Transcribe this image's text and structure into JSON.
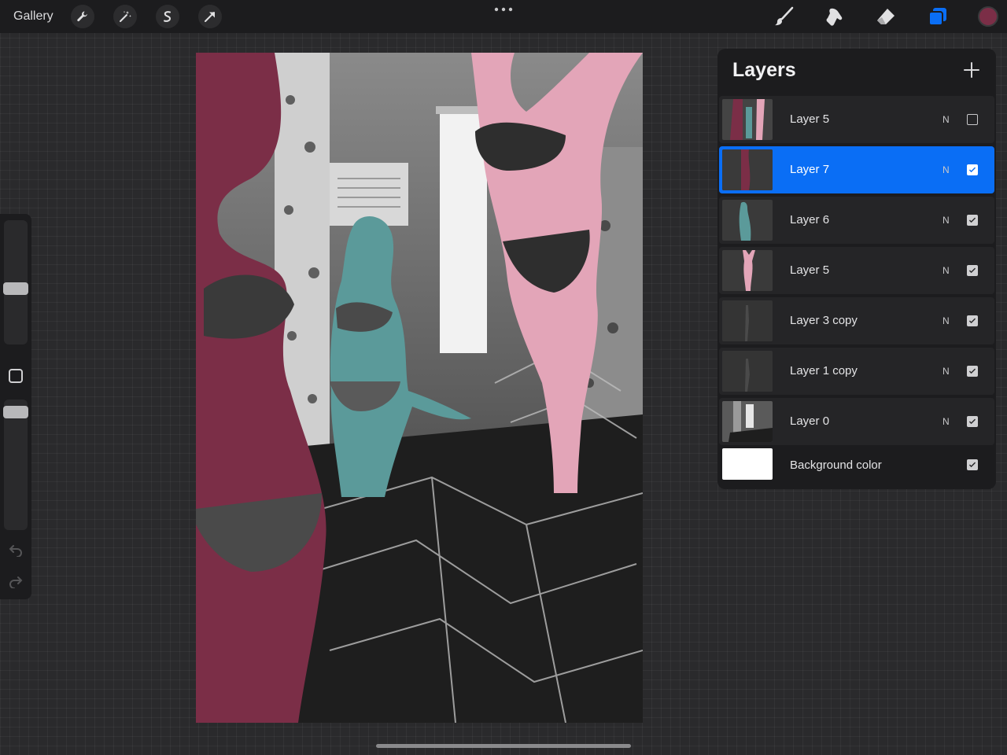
{
  "toolbar": {
    "gallery_label": "Gallery",
    "left_tools": [
      "wrench-icon",
      "magic-wand-icon",
      "selection-icon",
      "transform-arrow-icon"
    ],
    "right_tools": [
      "brush-icon",
      "smudge-icon",
      "eraser-icon",
      "layers-icon"
    ],
    "current_color": "#7b2e47",
    "accent": "#0a6ef5"
  },
  "layers_panel": {
    "title": "Layers",
    "layers": [
      {
        "name": "Layer 5",
        "blend": "N",
        "visible": false,
        "selected": false
      },
      {
        "name": "Layer 7",
        "blend": "N",
        "visible": true,
        "selected": true
      },
      {
        "name": "Layer 6",
        "blend": "N",
        "visible": true,
        "selected": false
      },
      {
        "name": "Layer 5",
        "blend": "N",
        "visible": true,
        "selected": false
      },
      {
        "name": "Layer 3 copy",
        "blend": "N",
        "visible": true,
        "selected": false
      },
      {
        "name": "Layer 1 copy",
        "blend": "N",
        "visible": true,
        "selected": false
      },
      {
        "name": "Layer 0",
        "blend": "N",
        "visible": true,
        "selected": false
      }
    ],
    "background": {
      "name": "Background color",
      "visible": true
    }
  },
  "canvas_colors": {
    "maroon": "#7b2e47",
    "teal": "#5b9a9a",
    "pink": "#e3a5b8"
  }
}
